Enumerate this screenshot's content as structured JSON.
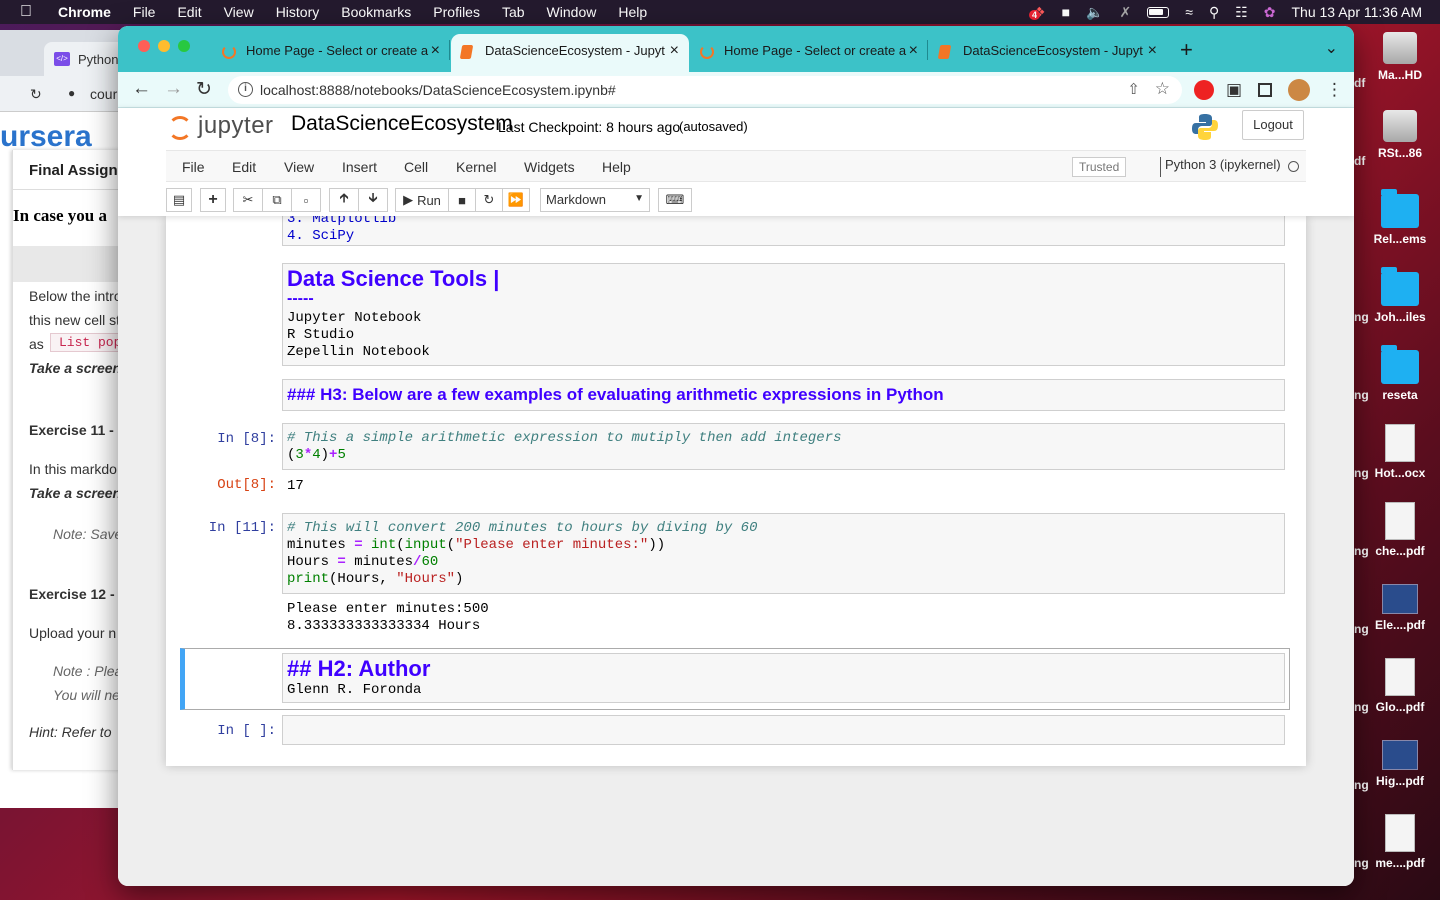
{
  "menubar": {
    "app": "Chrome",
    "items": [
      "File",
      "Edit",
      "View",
      "History",
      "Bookmarks",
      "Profiles",
      "Tab",
      "Window",
      "Help"
    ],
    "badge": "4",
    "datetime": "Thu 13 Apr  11:36 AM"
  },
  "background_window": {
    "tab": "Python",
    "addr": "cour",
    "brand": "ursera",
    "panel_title": "Final Assignm",
    "heading": "In case you a",
    "lines": [
      "Below the intro",
      "this new cell st",
      "as",
      "Take a screen",
      "Exercise 11 - ",
      "In this markdo",
      "Take a screen",
      "Note: Save",
      "Exercise 12 - ",
      "Upload your n",
      "Note : Plea",
      "You will ne",
      "Hint: Refer to"
    ],
    "code_chip": "List pop"
  },
  "desktop": [
    {
      "label": "Ma...HD",
      "icon": "drive-icon"
    },
    {
      "label": "RSt...86",
      "icon": "drive-icon"
    },
    {
      "label": "Rel...ems",
      "icon": "folder-icon"
    },
    {
      "label": "Joh...iles",
      "icon": "folder-icon"
    },
    {
      "label": "reseta",
      "icon": "folder-icon"
    },
    {
      "label": "Hot...ocx",
      "icon": "docx-icon"
    },
    {
      "label": "che...pdf",
      "icon": "pdf-icon"
    },
    {
      "label": "Ele....pdf",
      "icon": "pdf-icon"
    },
    {
      "label": "Glo...pdf",
      "icon": "pdf-icon"
    },
    {
      "label": "Hig...pdf",
      "icon": "pdf-icon"
    },
    {
      "label": "me....pdf",
      "icon": "pdf-icon"
    }
  ],
  "desktop_left_labels": [
    "df",
    "df",
    "ng",
    "ng",
    "ng",
    "ng",
    "ng",
    "ng",
    "ng",
    "ng"
  ],
  "tabs": [
    {
      "title": "Home Page - Select or create a",
      "active": false
    },
    {
      "title": "DataScienceEcosystem - Jupyt",
      "active": true
    },
    {
      "title": "Home Page - Select or create a",
      "active": false
    },
    {
      "title": "DataScienceEcosystem - Jupyt",
      "active": false
    }
  ],
  "address": "localhost:8888/notebooks/DataScienceEcosystem.ipynb#",
  "jupyter": {
    "logo_text": "jupyter",
    "notebook_name": "DataScienceEcosystem",
    "checkpoint": "Last Checkpoint: 8 hours ago",
    "autosave": "(autosaved)",
    "logout": "Logout",
    "menu": [
      "File",
      "Edit",
      "View",
      "Insert",
      "Cell",
      "Kernel",
      "Widgets",
      "Help"
    ],
    "trusted": "Trusted",
    "kernel": "Python 3 (ipykernel)",
    "run_label": "Run",
    "cell_type": "Markdown"
  },
  "cells": {
    "list_tail": [
      "3. Matplotlib",
      "4. SciPy"
    ],
    "tools_heading": "Data Science Tools |",
    "tools_rule": "-----",
    "tools": [
      "Jupyter Notebook",
      "R Studio",
      "Zepellin Notebook"
    ],
    "h3": "### H3: Below are a few examples of evaluating arithmetic expressions in Python",
    "in8_prompt": "In [8]:",
    "in8_comment": "# This a simple arithmetic expression to mutiply then add integers",
    "out8_prompt": "Out[8]:",
    "out8": "17",
    "in11_prompt": "In [11]:",
    "in11_comment": "# This will convert 200 minutes to hours by diving by 60",
    "out11_lines": [
      "Please enter minutes:500",
      "8.333333333333334 Hours"
    ],
    "h2": "## H2: Author",
    "author": "Glenn R. Foronda",
    "empty_prompt": "In [ ]:"
  }
}
